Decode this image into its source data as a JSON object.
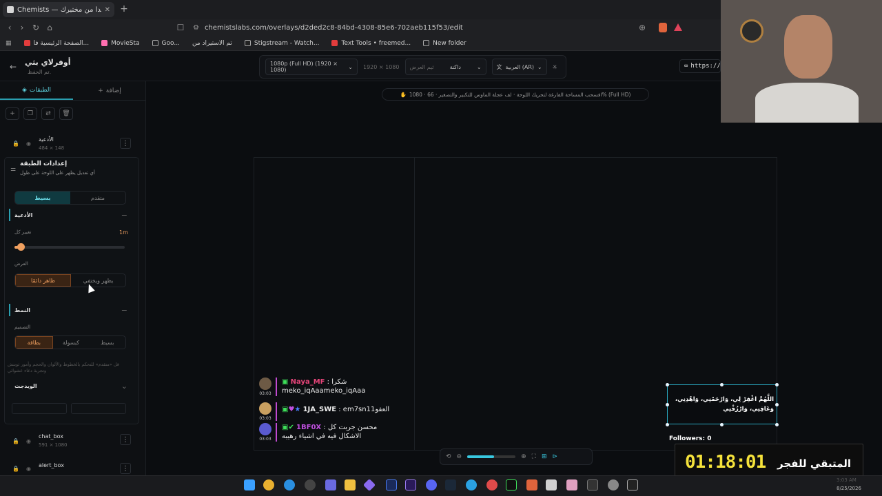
{
  "browser": {
    "tab_title": "Chemists — تفاعل يبدأ من مختبرك",
    "url": "chemistslabs.com/overlays/d2ded2c8-84bd-4308-85e6-702aeb115f53/edit",
    "bookmarks": [
      "الصفحة الرئيسية فا...",
      "MovieSta",
      "Goo...",
      "تم الاستيراد من",
      "Stigstream - Watch...",
      "Text Tools • freemed...",
      "New folder"
    ]
  },
  "header": {
    "overlay_title": "أوفرلاي بثي",
    "saved_status": "تم الحفظ.",
    "resolution": "1080p (Full HD) (1920 × 1080)",
    "dimensions": "1920 × 1080",
    "theme_label": "ثيم العرض",
    "theme": "داكنة",
    "language": "العربية (AR)",
    "url_preview": "https://c"
  },
  "canvas_hint": "1080 · افسحب المساحة الفارغة لتحريك اللوحة · لف عجلة الماوس للتكبير والتصغير · 66% (Full HD)",
  "sidebar": {
    "tab_layers": "الطبقات",
    "tab_add": "إضافة",
    "layer_active": {
      "name": "الأدعية",
      "size": "484 × 148"
    },
    "settings_title": "إعدادات الطبقة",
    "settings_sub": "أي تعديل يظهر على اللوحة على طول",
    "mode_simple": "بسيط",
    "mode_advanced": "متقدم",
    "sec_duas": "الأدعية",
    "change_every": "تغيير كل",
    "change_value": "1m",
    "display_label": "العرض",
    "display_always": "ظاهر دائمًا",
    "display_toggle": "يظهر ويختفي",
    "sec_style": "النمط",
    "design_label": "التصميم",
    "design_card": "بطاقة",
    "design_capsule": "كبسولة",
    "design_simple": "بسيط",
    "style_note": "قل «متقدم» للتحكم بالخطوط والألوان والحجم وأمور ثوبتش وتجربة دعاء عشوائي",
    "sec_widget": "الويدجت",
    "layers_below": [
      {
        "name": "chat_box",
        "size": "591 × 1080"
      },
      {
        "name": "alert_box",
        "size": ""
      }
    ]
  },
  "chat": [
    {
      "user": "Naya_MF",
      "text": "شكرا",
      "line2": "meko_iqAaameko_iqAaa",
      "time": "03:03",
      "color": "#e8457a"
    },
    {
      "user": "1JA_SWE",
      "text": "em7sn11العفو",
      "line2": "",
      "time": "03:03",
      "color": "#ffffff"
    },
    {
      "user": "1BF0X",
      "text": "محسن جربت كل",
      "line2": "الاشكال فيه في اشياء رهيبه",
      "time": "03:03",
      "color": "#c050e0"
    }
  ],
  "dua": "اللَّهُمَّ اغْفِرْ لِي، وَارْحَمْنِي، وَاهْدِنِي، وَعَافِنِي، وَارْزُقْنِي",
  "followers": "Followers: 0",
  "timer": {
    "value": "01:18:01",
    "label": "المتبقي للفجر"
  },
  "zoom": {
    "level": 0.55
  },
  "taskbar": {
    "time": "3:03 AM",
    "date": "8/25/2026"
  }
}
